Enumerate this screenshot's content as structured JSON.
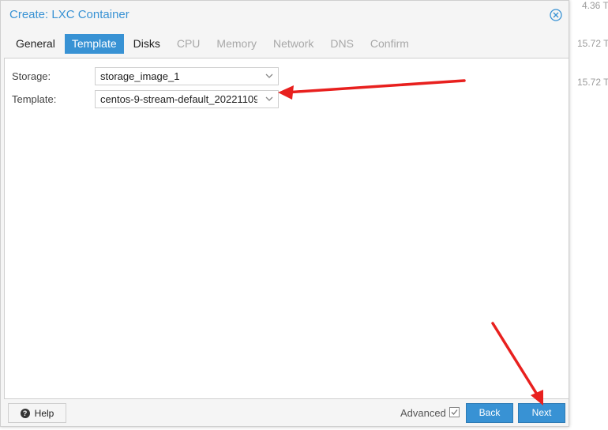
{
  "background": {
    "values": [
      "4.36 T",
      "15.72 T",
      "15.72 T"
    ]
  },
  "dialog": {
    "title": "Create: LXC Container",
    "tabs": [
      {
        "label": "General",
        "state": "normal"
      },
      {
        "label": "Template",
        "state": "active"
      },
      {
        "label": "Disks",
        "state": "normal"
      },
      {
        "label": "CPU",
        "state": "disabled"
      },
      {
        "label": "Memory",
        "state": "disabled"
      },
      {
        "label": "Network",
        "state": "disabled"
      },
      {
        "label": "DNS",
        "state": "disabled"
      },
      {
        "label": "Confirm",
        "state": "disabled"
      }
    ],
    "form": {
      "storage": {
        "label": "Storage:",
        "value": "storage_image_1"
      },
      "template": {
        "label": "Template:",
        "value": "centos-9-stream-default_20221109"
      }
    },
    "footer": {
      "help_label": "Help",
      "advanced_label": "Advanced",
      "advanced_checked": true,
      "back_label": "Back",
      "next_label": "Next"
    }
  },
  "colors": {
    "accent": "#3892d4",
    "annotation_arrow": "#e8201e"
  },
  "icons": {
    "close": "close-circle-icon",
    "help": "question-circle-icon",
    "combo": "chevron-down-icon"
  }
}
